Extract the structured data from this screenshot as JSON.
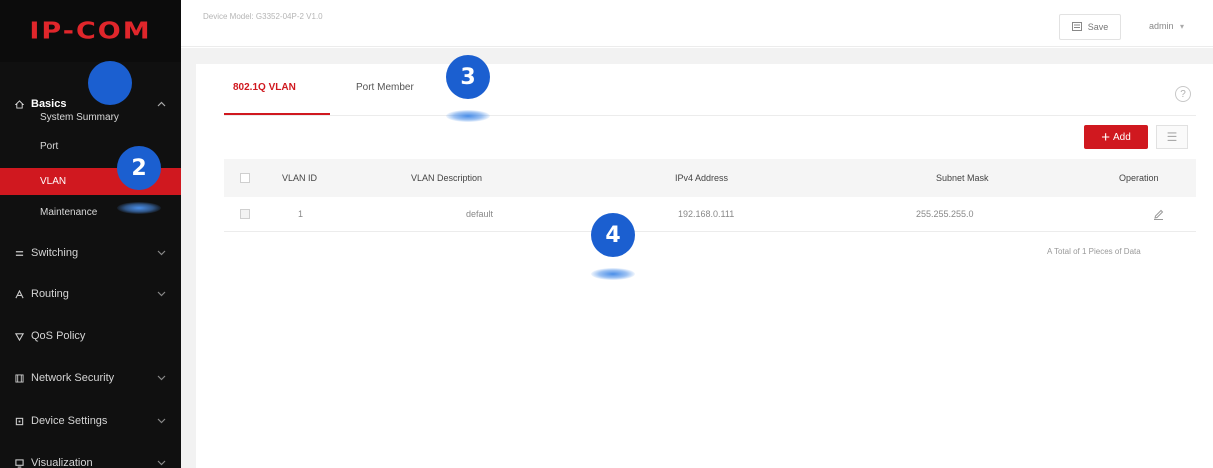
{
  "app": {
    "logo_text": "IP-COM",
    "brand_color": "#d0181f"
  },
  "header": {
    "device_info": "Device Model: G3352-04P-2 V1.0",
    "save_label": "Save",
    "user_label": "admin"
  },
  "sidebar": {
    "groups": [
      {
        "label": "Basics",
        "icon": "home-icon",
        "expanded": true
      },
      {
        "label": "Switching",
        "icon": "switching-icon"
      },
      {
        "label": "Routing",
        "icon": "routing-icon"
      },
      {
        "label": "QoS Policy",
        "icon": "qos-icon"
      },
      {
        "label": "Network Security",
        "icon": "shield-icon"
      },
      {
        "label": "Device Settings",
        "icon": "gear-icon"
      },
      {
        "label": "Visualization",
        "icon": "monitor-icon"
      }
    ],
    "basics_items": [
      {
        "label": "System Summary"
      },
      {
        "label": "Port"
      },
      {
        "label": "VLAN",
        "active": true
      },
      {
        "label": "Maintenance"
      }
    ]
  },
  "tabs": [
    {
      "label": "802.1Q VLAN",
      "active": true
    },
    {
      "label": "Port Member"
    }
  ],
  "toolbar": {
    "add_label": "Add",
    "add_icon": "plus-icon",
    "list_icon": "list-icon"
  },
  "table": {
    "columns": [
      "VLAN ID",
      "VLAN Description",
      "IPv4 Address",
      "Subnet Mask",
      "Operation"
    ],
    "rows": [
      {
        "vlan_id": "1",
        "description": "default",
        "ipv4": "192.168.0.111",
        "mask": "255.255.255.0",
        "operation_icon": "edit-icon"
      }
    ]
  },
  "pagination": {
    "summary": "A Total of 1 Pieces of Data"
  },
  "tutorial_badges": [
    "2",
    "3",
    "4"
  ]
}
